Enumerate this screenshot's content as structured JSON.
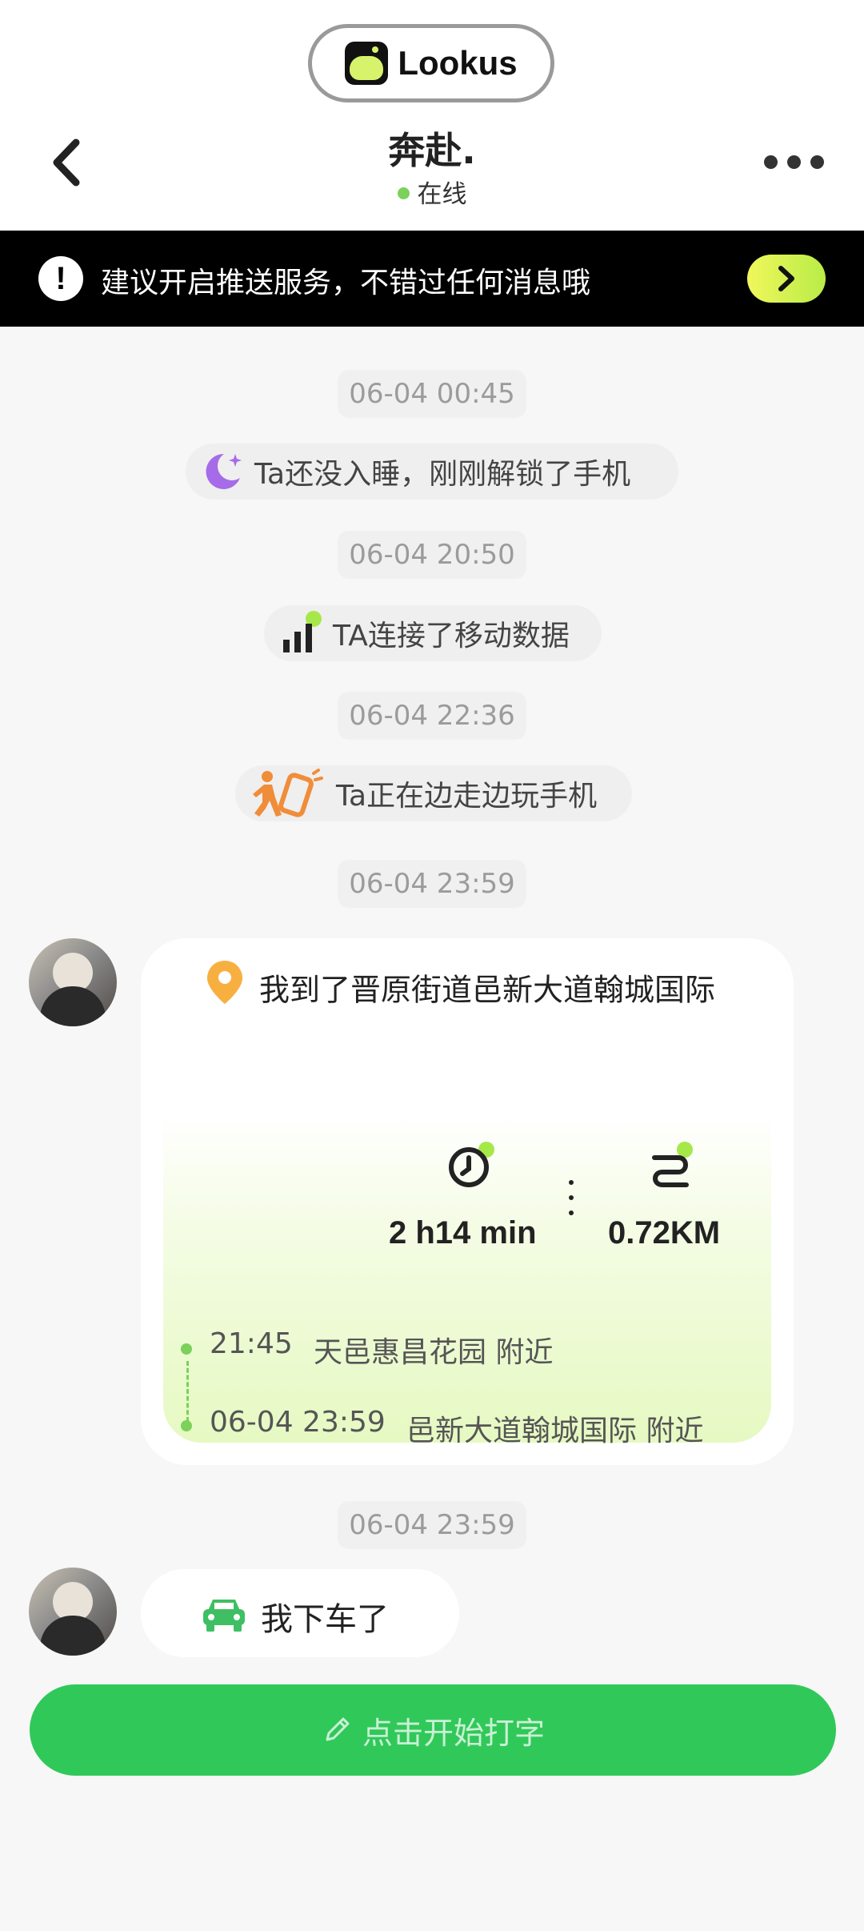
{
  "app": {
    "brand": "Lookus"
  },
  "header": {
    "title": "奔赴.",
    "status": "在线"
  },
  "banner": {
    "text": "建议开启推送服务，不错过任何消息哦"
  },
  "feed": {
    "ts1": "06-04 00:45",
    "event1": "Ta还没入睡，刚刚解锁了手机",
    "ts2": "06-04 20:50",
    "event2": "TA连接了移动数据",
    "ts3": "06-04 22:36",
    "event3": "Ta正在边走边玩手机",
    "ts4": "06-04 23:59",
    "ts5": "06-04 23:59"
  },
  "location_card": {
    "location_text": "我到了晋原街道邑新大道翰城国际",
    "duration": "2 h14 min",
    "distance": "0.72KM",
    "start_time": "21:45",
    "start_place": "天邑惠昌花园 附近",
    "end_time": "06-04 23:59",
    "end_place": "邑新大道翰城国际 附近"
  },
  "car_message": {
    "text": "我下车了"
  },
  "input": {
    "placeholder": "点击开始打字"
  },
  "colors": {
    "accent_green": "#31c85a",
    "online_dot": "#7bd15a",
    "banner_bg": "#000000",
    "banner_button": "#d7f26b"
  },
  "icons": [
    "back-icon",
    "more-icon",
    "alert-icon",
    "chevron-right-icon",
    "moon-icon",
    "signal-icon",
    "walking-phone-icon",
    "location-pin-icon",
    "timer-icon",
    "route-icon",
    "car-icon",
    "pencil-icon"
  ]
}
